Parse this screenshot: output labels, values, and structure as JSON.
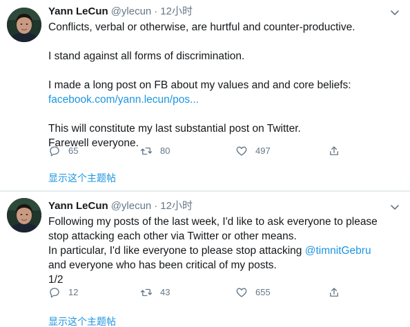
{
  "tweets": [
    {
      "author": {
        "name": "Yann LeCun",
        "handle": "@ylecun",
        "separator": "·",
        "time": "12小时"
      },
      "body": {
        "line1": "Conflicts, verbal or otherwise, are hurtful and counter-productive.",
        "line2": "I stand against all forms of discrimination.",
        "line3": "I made a long post on FB about my values and and core beliefs:",
        "link": "facebook.com/yann.lecun/pos...",
        "line5": "This will constitute my last substantial post on Twitter.",
        "line6": "Farewell everyone."
      },
      "actions": {
        "replies": "65",
        "retweets": "80",
        "likes": "497"
      },
      "show_thread": "显示这个主题帖"
    },
    {
      "author": {
        "name": "Yann LeCun",
        "handle": "@ylecun",
        "separator": "·",
        "time": "12小时"
      },
      "body": {
        "line1": "Following my posts of the last week, I'd like to ask everyone to please",
        "line2": "stop attacking each other via Twitter or other means.",
        "line3_prefix": "In particular, I'd like everyone to please stop attacking ",
        "mention": "@timnitGebru",
        "line4": "and everyone who has been critical of my posts.",
        "line5": "1/2"
      },
      "actions": {
        "replies": "12",
        "retweets": "43",
        "likes": "655"
      },
      "show_thread": "显示这个主题帖"
    }
  ],
  "colors": {
    "link": "#1b95e0",
    "secondary_text": "#657786",
    "primary_text": "#14171a",
    "divider": "#e6ecf0"
  },
  "icons": {
    "reply": "reply-icon",
    "retweet": "retweet-icon",
    "like": "heart-icon",
    "share": "share-icon",
    "more": "chevron-down-icon"
  }
}
